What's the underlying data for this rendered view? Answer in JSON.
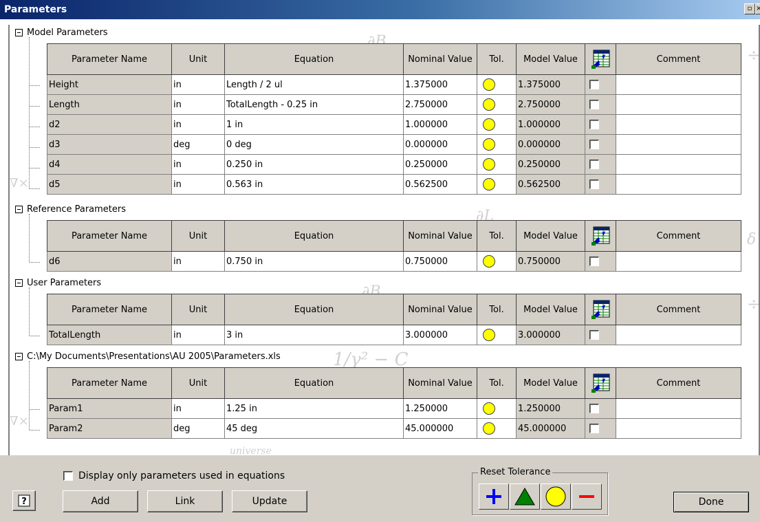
{
  "window": {
    "title": "Parameters"
  },
  "columns": [
    "Parameter Name",
    "Unit",
    "Equation",
    "Nominal Value",
    "Tol.",
    "Model Value",
    "Comment"
  ],
  "groups": [
    {
      "label": "Model Parameters",
      "rows": [
        {
          "name": "Height",
          "unit": "in",
          "equation": "Length / 2 ul",
          "nominal": "1.375000",
          "model": "1.375000",
          "comment": ""
        },
        {
          "name": "Length",
          "unit": "in",
          "equation": "TotalLength - 0.25 in",
          "nominal": "2.750000",
          "model": "2.750000",
          "comment": ""
        },
        {
          "name": "d2",
          "unit": "in",
          "equation": "1 in",
          "nominal": "1.000000",
          "model": "1.000000",
          "comment": ""
        },
        {
          "name": "d3",
          "unit": "deg",
          "equation": "0 deg",
          "nominal": "0.000000",
          "model": "0.000000",
          "comment": ""
        },
        {
          "name": "d4",
          "unit": "in",
          "equation": "0.250 in",
          "nominal": "0.250000",
          "model": "0.250000",
          "comment": ""
        },
        {
          "name": "d5",
          "unit": "in",
          "equation": "0.563 in",
          "nominal": "0.562500",
          "model": "0.562500",
          "comment": ""
        }
      ]
    },
    {
      "label": "Reference Parameters",
      "rows": [
        {
          "name": "d6",
          "unit": "in",
          "equation": "0.750 in",
          "nominal": "0.750000",
          "model": "0.750000",
          "comment": ""
        }
      ]
    },
    {
      "label": "User Parameters",
      "rows": [
        {
          "name": "TotalLength",
          "unit": "in",
          "equation": "3 in",
          "nominal": "3.000000",
          "model": "3.000000",
          "comment": ""
        }
      ]
    },
    {
      "label": "C:\\My Documents\\Presentations\\AU 2005\\Parameters.xls",
      "rows": [
        {
          "name": "Param1",
          "unit": "in",
          "equation": "1.25 in",
          "nominal": "1.250000",
          "model": "1.250000",
          "comment": ""
        },
        {
          "name": "Param2",
          "unit": "deg",
          "equation": "45 deg",
          "nominal": "45.000000",
          "model": "45.000000",
          "comment": ""
        }
      ]
    }
  ],
  "footer": {
    "display_only_used": "Display only parameters used in equations",
    "add": "Add",
    "link": "Link",
    "update": "Update",
    "reset_tolerance": "Reset Tolerance",
    "done": "Done"
  },
  "icons": {
    "tol_upper": "plus-icon",
    "tol_median": "triangle-icon",
    "tol_nominal": "circle-icon",
    "tol_lower": "minus-icon",
    "export": "spreadsheet-export-icon",
    "help": "help-icon"
  },
  "colors": {
    "tolerance_circle": "#ffff00",
    "plus": "#0000ff",
    "triangle": "#008000",
    "minus": "#ff0000",
    "title_bar": "#0a246a",
    "readonly_cell": "#d4d0c8"
  }
}
